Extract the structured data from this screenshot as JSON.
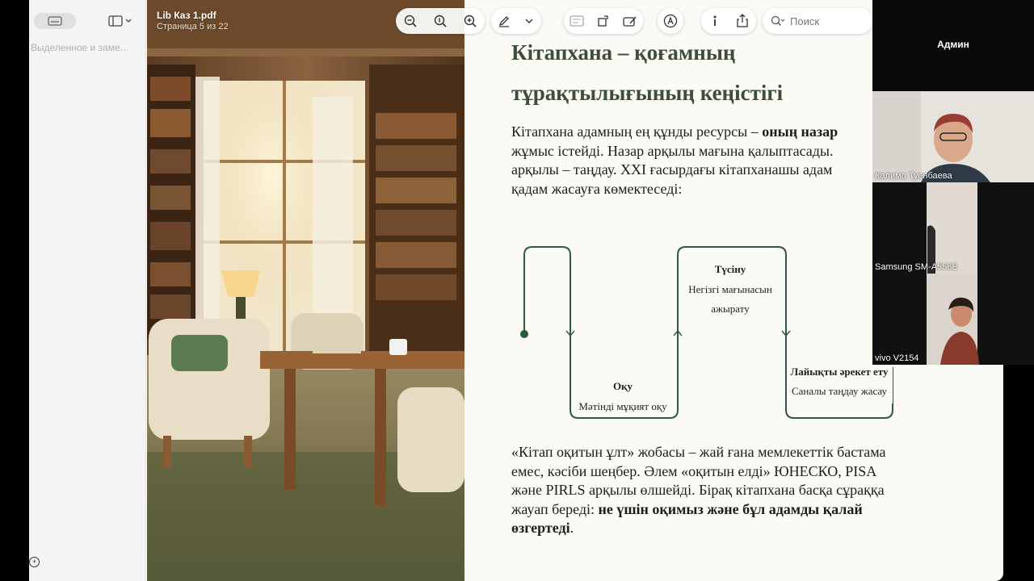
{
  "sidebar": {
    "label": "Выделенное и заме..."
  },
  "document": {
    "title": "Lib Каз 1.pdf",
    "subtitle": "Страница 5 из 22"
  },
  "search": {
    "placeholder": "Поиск"
  },
  "slide": {
    "title_line1": "Кітапхана – қоғамның",
    "title_line2": "тұрақтылығының кеңістігі",
    "intro": {
      "line1_plain": "Кітапхана адамның ең құнды ресурсы – ",
      "line1_bold": "оның назар",
      "line2": "жұмыс істейді. Назар арқылы мағына қалыптасады.",
      "line3": "арқылы – таңдау. XXI ғасырдағы кітапханашы адам",
      "line4": "қадам жасауға көмектеседі:"
    },
    "steps": [
      {
        "title": "Оқу",
        "desc": "Мәтінді мұқият оқу"
      },
      {
        "title": "Түсіну",
        "desc_line1": "Негізгі мағынасын",
        "desc_line2": "ажырату"
      },
      {
        "title": "Лайықты әрекет ету",
        "desc": "Саналы таңдау жасау"
      }
    ],
    "outro": {
      "line1": "«Кітап оқитын ұлт» жобасы – жай ғана мемлекеттік бастама",
      "line2": "емес, кәсіби шеңбер. Әлем «оқитын елді» ЮНЕСКО, PISA",
      "line3": "және PIRLS арқылы өлшейді. Бірақ кітапхана басқа сұраққа",
      "line4_plain": "жауап береді: ",
      "line4_bold": "не үшін оқимыз және бұл адамды қалай",
      "line5_bold": "өзгертеді",
      "line5_plain": "."
    }
  },
  "video": {
    "host": "Админ",
    "participants": [
      {
        "name": "Калима Туенбаева"
      },
      {
        "name": "Samsung SM-A556E"
      },
      {
        "name": "vivo V2154"
      }
    ]
  },
  "colors": {
    "accent": "#2c5a3c",
    "title": "#3d4e38"
  }
}
